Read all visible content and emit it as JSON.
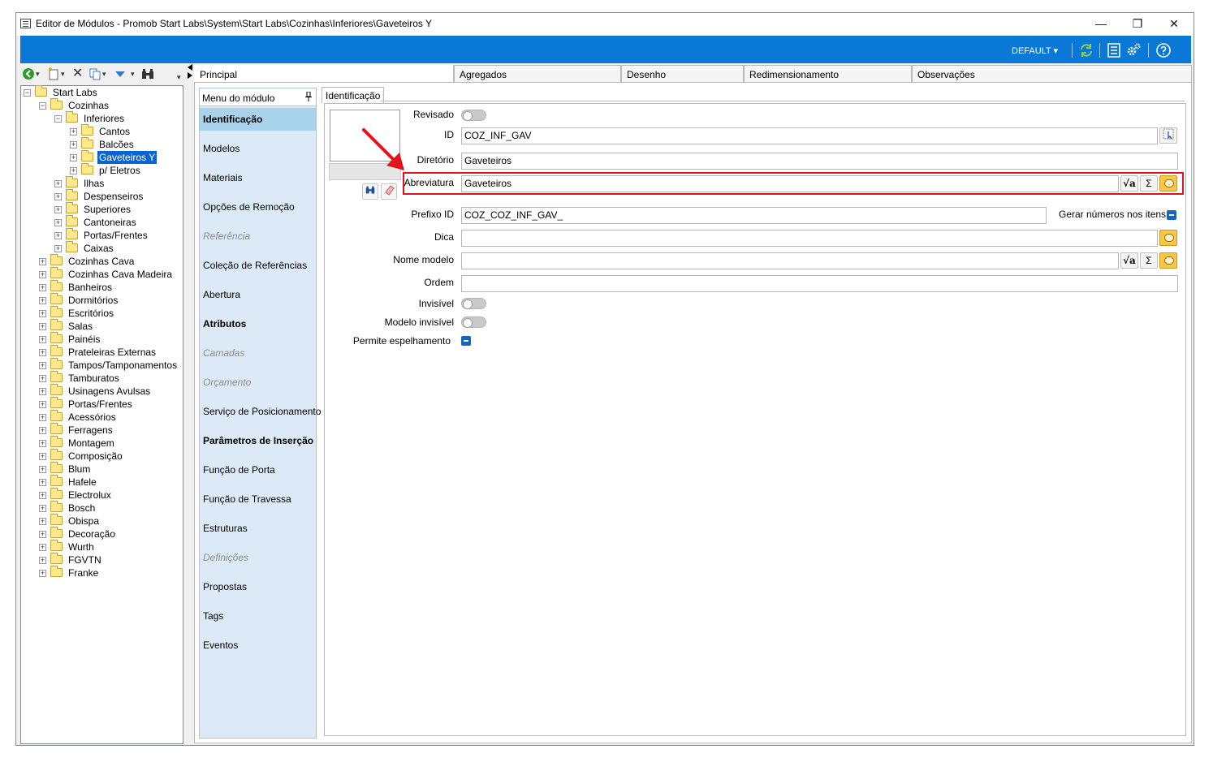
{
  "window": {
    "title": "Editor de Módulos - Promob Start Labs\\System\\Start Labs\\Cozinhas\\Inferiores\\Gaveteiros Y",
    "minimize_glyph": "—",
    "restore_glyph": "❐",
    "close_glyph": "✕"
  },
  "ribbon": {
    "profile_label": "DEFAULT ▾",
    "accent_color": "#0a78d7"
  },
  "tree": {
    "toolbar_icons": [
      "back-icon",
      "new-icon",
      "delete-icon",
      "copy-icon",
      "move-down-icon",
      "search-icon"
    ],
    "items": [
      {
        "label": "Start Labs",
        "level": 0,
        "expanded": true
      },
      {
        "label": "Cozinhas",
        "level": 1,
        "expanded": true
      },
      {
        "label": "Inferiores",
        "level": 2,
        "expanded": true
      },
      {
        "label": "Cantos",
        "level": 3,
        "expanded": false
      },
      {
        "label": "Balcões",
        "level": 3,
        "expanded": false
      },
      {
        "label": "Gaveteiros Y",
        "level": 3,
        "expanded": false,
        "selected": true
      },
      {
        "label": "p/ Eletros",
        "level": 3,
        "expanded": false
      },
      {
        "label": "Ilhas",
        "level": 2,
        "expanded": false
      },
      {
        "label": "Despenseiros",
        "level": 2,
        "expanded": false
      },
      {
        "label": "Superiores",
        "level": 2,
        "expanded": false
      },
      {
        "label": "Cantoneiras",
        "level": 2,
        "expanded": false
      },
      {
        "label": "Portas/Frentes",
        "level": 2,
        "expanded": false
      },
      {
        "label": "Caixas",
        "level": 2,
        "expanded": false
      },
      {
        "label": "Cozinhas Cava",
        "level": 1,
        "expanded": false
      },
      {
        "label": "Cozinhas Cava Madeira",
        "level": 1,
        "expanded": false
      },
      {
        "label": "Banheiros",
        "level": 1,
        "expanded": false
      },
      {
        "label": "Dormitórios",
        "level": 1,
        "expanded": false
      },
      {
        "label": "Escritórios",
        "level": 1,
        "expanded": false
      },
      {
        "label": "Salas",
        "level": 1,
        "expanded": false
      },
      {
        "label": "Painéis",
        "level": 1,
        "expanded": false
      },
      {
        "label": "Prateleiras Externas",
        "level": 1,
        "expanded": false
      },
      {
        "label": "Tampos/Tamponamentos",
        "level": 1,
        "expanded": false
      },
      {
        "label": "Tamburatos",
        "level": 1,
        "expanded": false
      },
      {
        "label": "Usinagens Avulsas",
        "level": 1,
        "expanded": false
      },
      {
        "label": "Portas/Frentes",
        "level": 1,
        "expanded": false
      },
      {
        "label": "Acessórios",
        "level": 1,
        "expanded": false
      },
      {
        "label": "Ferragens",
        "level": 1,
        "expanded": false
      },
      {
        "label": "Montagem",
        "level": 1,
        "expanded": false
      },
      {
        "label": "Composição",
        "level": 1,
        "expanded": false
      },
      {
        "label": "Blum",
        "level": 1,
        "expanded": false
      },
      {
        "label": "Hafele",
        "level": 1,
        "expanded": false
      },
      {
        "label": "Electrolux",
        "level": 1,
        "expanded": false
      },
      {
        "label": "Bosch",
        "level": 1,
        "expanded": false
      },
      {
        "label": "Obispa",
        "level": 1,
        "expanded": false
      },
      {
        "label": "Decoração",
        "level": 1,
        "expanded": false
      },
      {
        "label": "Wurth",
        "level": 1,
        "expanded": false
      },
      {
        "label": "FGVTN",
        "level": 1,
        "expanded": false
      },
      {
        "label": "Franke",
        "level": 1,
        "expanded": false
      }
    ]
  },
  "tabs": [
    {
      "label": "Principal",
      "active": true
    },
    {
      "label": "Agregados",
      "active": false
    },
    {
      "label": "Desenho",
      "active": false
    },
    {
      "label": "Redimensionamento",
      "active": false
    },
    {
      "label": "Observações",
      "active": false
    }
  ],
  "menu": {
    "header": "Menu do módulo",
    "pin_glyph": "ꟷ",
    "items": [
      {
        "label": "Identificação",
        "state": "selected"
      },
      {
        "label": "Modelos",
        "state": "normal"
      },
      {
        "label": "Materiais",
        "state": "normal"
      },
      {
        "label": "Opções de Remoção",
        "state": "normal"
      },
      {
        "label": "Referência",
        "state": "disabled"
      },
      {
        "label": "Coleção de Referências",
        "state": "normal"
      },
      {
        "label": "Abertura",
        "state": "normal"
      },
      {
        "label": "Atributos",
        "state": "bold"
      },
      {
        "label": "Camadas",
        "state": "disabled"
      },
      {
        "label": "Orçamento",
        "state": "disabled"
      },
      {
        "label": "Serviço de Posicionamento",
        "state": "normal"
      },
      {
        "label": "Parâmetros de Inserção",
        "state": "bold"
      },
      {
        "label": "Função de Porta",
        "state": "normal"
      },
      {
        "label": "Função de Travessa",
        "state": "normal"
      },
      {
        "label": "Estruturas",
        "state": "normal"
      },
      {
        "label": "Definições",
        "state": "disabled"
      },
      {
        "label": "Propostas",
        "state": "normal"
      },
      {
        "label": "Tags",
        "state": "normal"
      },
      {
        "label": "Eventos",
        "state": "normal"
      }
    ]
  },
  "identificacao": {
    "tab_label": "Identificação",
    "fields": {
      "revisado": {
        "label": "Revisado",
        "value": false
      },
      "id": {
        "label": "ID",
        "value": "COZ_INF_GAV"
      },
      "diretorio": {
        "label": "Diretório",
        "value": "Gaveteiros"
      },
      "abreviatura": {
        "label": "Abreviatura",
        "value": "Gaveteiros"
      },
      "prefixo_id": {
        "label": "Prefixo ID",
        "value": "COZ_COZ_INF_GAV_"
      },
      "gerar_numeros": {
        "label": "Gerar números nos itens",
        "value": true
      },
      "dica": {
        "label": "Dica",
        "value": ""
      },
      "nome_modelo": {
        "label": "Nome modelo",
        "value": ""
      },
      "ordem": {
        "label": "Ordem",
        "value": ""
      },
      "invisivel": {
        "label": "Invisível",
        "value": false
      },
      "modelo_invisivel": {
        "label": "Modelo invisível",
        "value": false
      },
      "permite_espelhamento": {
        "label": "Permite espelhamento",
        "value": true
      }
    },
    "sigma_glyph": "Σ",
    "sqrt_glyph": "√a"
  },
  "annotation": {
    "highlight_color": "#e0141c"
  }
}
